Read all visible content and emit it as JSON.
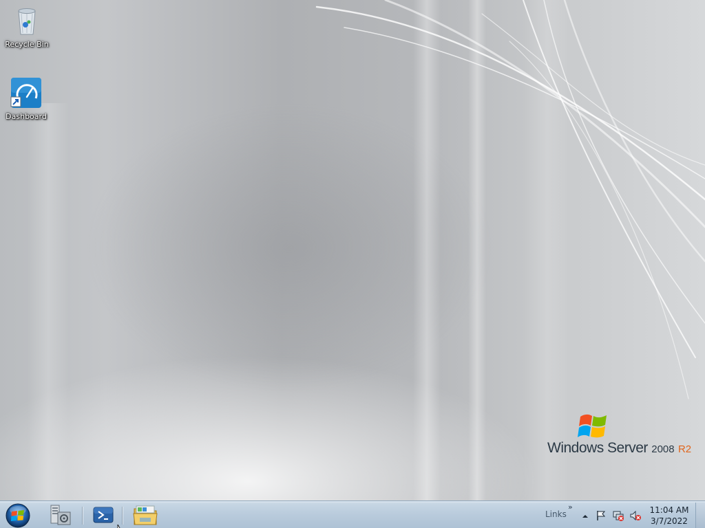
{
  "desktop": {
    "icons": [
      {
        "label": "Recycle Bin",
        "icon": "recycle-bin-icon"
      },
      {
        "label": "Dashboard",
        "icon": "dashboard-icon"
      }
    ]
  },
  "brand": {
    "name": "Windows Server",
    "version": "2008",
    "edition": "R2"
  },
  "taskbar": {
    "start_icon": "windows-start-orb-icon",
    "pinned": [
      {
        "name": "server-manager",
        "icon": "server-manager-icon"
      },
      {
        "name": "powershell",
        "icon": "powershell-icon"
      },
      {
        "name": "windows-explorer",
        "icon": "folder-icon"
      }
    ],
    "links_label": "Links",
    "links_chevron": "»",
    "tray": {
      "overflow_icon": "chevron-up-icon",
      "icons": [
        "action-center-flag-icon",
        "network-icon",
        "volume-muted-icon"
      ]
    },
    "clock": {
      "time": "11:04 AM",
      "date": "3/7/2022"
    }
  },
  "colors": {
    "taskbar": "#b9cbdc",
    "accent": "#e0651c",
    "desktop": "#b9bcbf"
  }
}
